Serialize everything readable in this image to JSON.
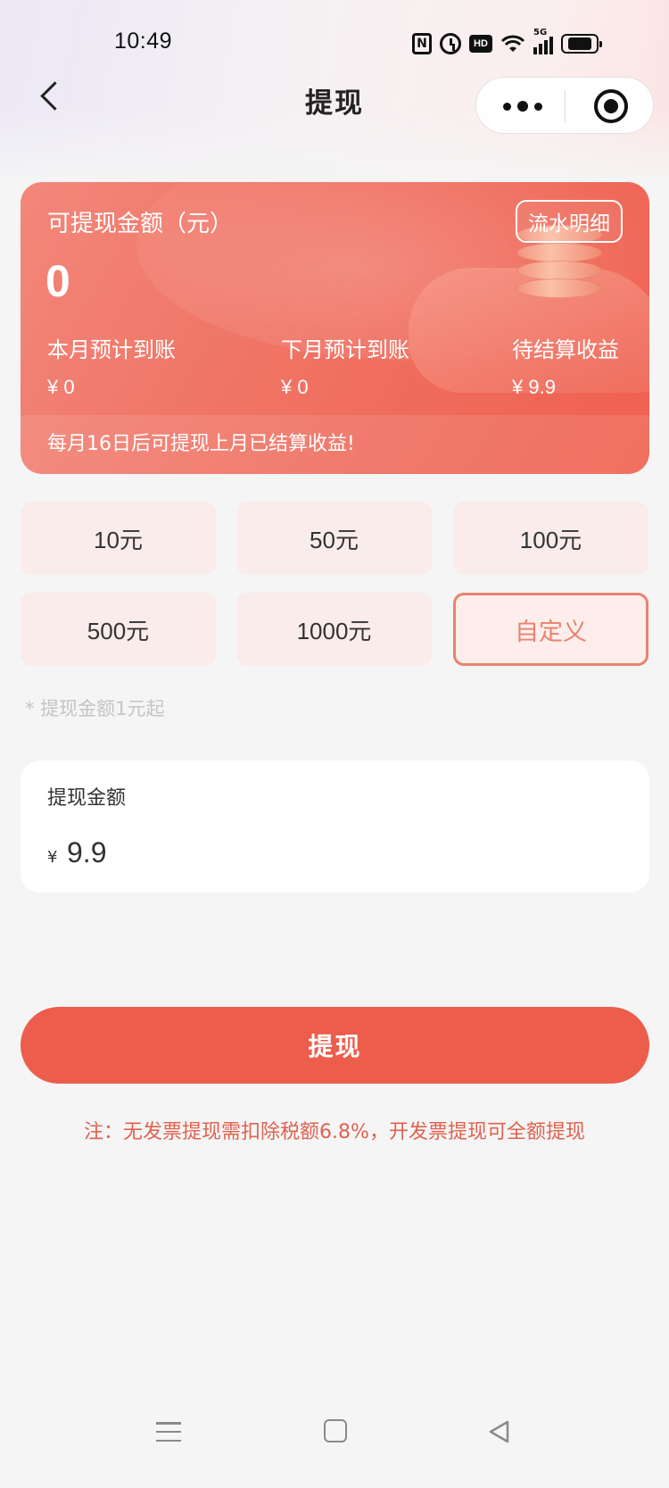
{
  "status_bar": {
    "time": "10:49",
    "icons": [
      "nfc-icon",
      "alarm-icon",
      "hd-icon",
      "wifi-icon",
      "signal-5g-icon",
      "battery-icon"
    ],
    "nfc_text": "N",
    "hd_text": "HD",
    "network_text": "5G"
  },
  "nav": {
    "title": "提现",
    "back_icon": "chevron-left-icon",
    "more_icon": "more-dots-icon",
    "close_icon": "target-close-icon"
  },
  "balance_card": {
    "label": "可提现金额（元）",
    "detail_button": "流水明细",
    "amount": "0",
    "stats": [
      {
        "title": "本月预计到账",
        "value": "¥ 0"
      },
      {
        "title": "下月预计到账",
        "value": "¥ 0"
      },
      {
        "title": "待结算收益",
        "value": "¥ 9.9"
      }
    ],
    "notice": "每月16日后可提现上月已结算收益!"
  },
  "amount_options": [
    "10元",
    "50元",
    "100元",
    "500元",
    "1000元",
    "自定义"
  ],
  "selected_option": "自定义",
  "min_hint": "* 提现金额1元起",
  "input": {
    "label": "提现金额",
    "currency": "¥",
    "value": "9.9"
  },
  "withdraw_button": "提现",
  "tax_note": "注：无发票提现需扣除税额6.8%，开发票提现可全额提现",
  "colors": {
    "accent": "#ec5d4c",
    "card_gradient_start": "#f2877a",
    "card_gradient_end": "#f0604f",
    "option_bg": "#f9ecea",
    "selected_border": "#e9826f",
    "note_text": "#e0624f",
    "background": "#f5f5f5"
  },
  "bottom_nav": {
    "icons": [
      "menu-icon",
      "home-square-icon",
      "back-triangle-icon"
    ]
  }
}
